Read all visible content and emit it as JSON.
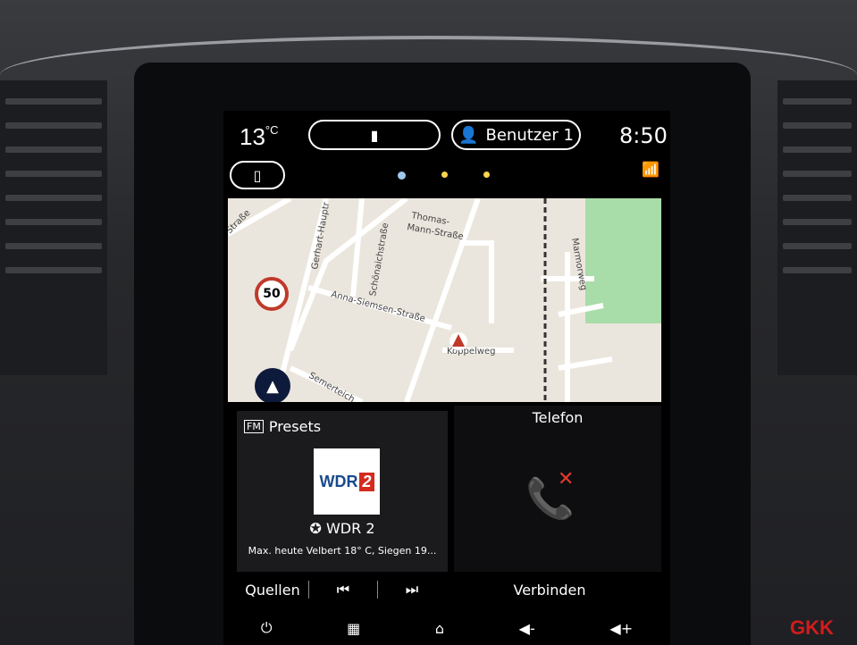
{
  "status": {
    "temperature": "13",
    "temp_unit": "°C",
    "user_label": "Benutzer 1",
    "time": "8:50"
  },
  "map": {
    "speed_limit": "50",
    "streets": [
      "Straße",
      "Gerhart-Hauptr",
      "Thomas-",
      "Mann-Straße",
      "Schönaichstraße",
      "Anna-Siemsen-Straße",
      "Marmorweg",
      "Koppelweg",
      "Semerteich"
    ]
  },
  "radio": {
    "header": "Presets",
    "logo_text": "WDR",
    "logo_num": "2",
    "station": "WDR 2",
    "radiotext": "Max. heute Velbert 18° C, Siegen 19..."
  },
  "phone": {
    "title": "Telefon",
    "connect": "Verbinden"
  },
  "controls": {
    "sources": "Quellen",
    "prev": "⏮",
    "next": "⏭"
  },
  "nav": {
    "power": "⏻",
    "apps": "▦",
    "home": "⌂",
    "vol_down": "◀-",
    "vol_up": "◀+"
  },
  "watermark": "GKK",
  "colors": {
    "accent": "#c0392b",
    "map_bg": "#ebe6dd"
  }
}
